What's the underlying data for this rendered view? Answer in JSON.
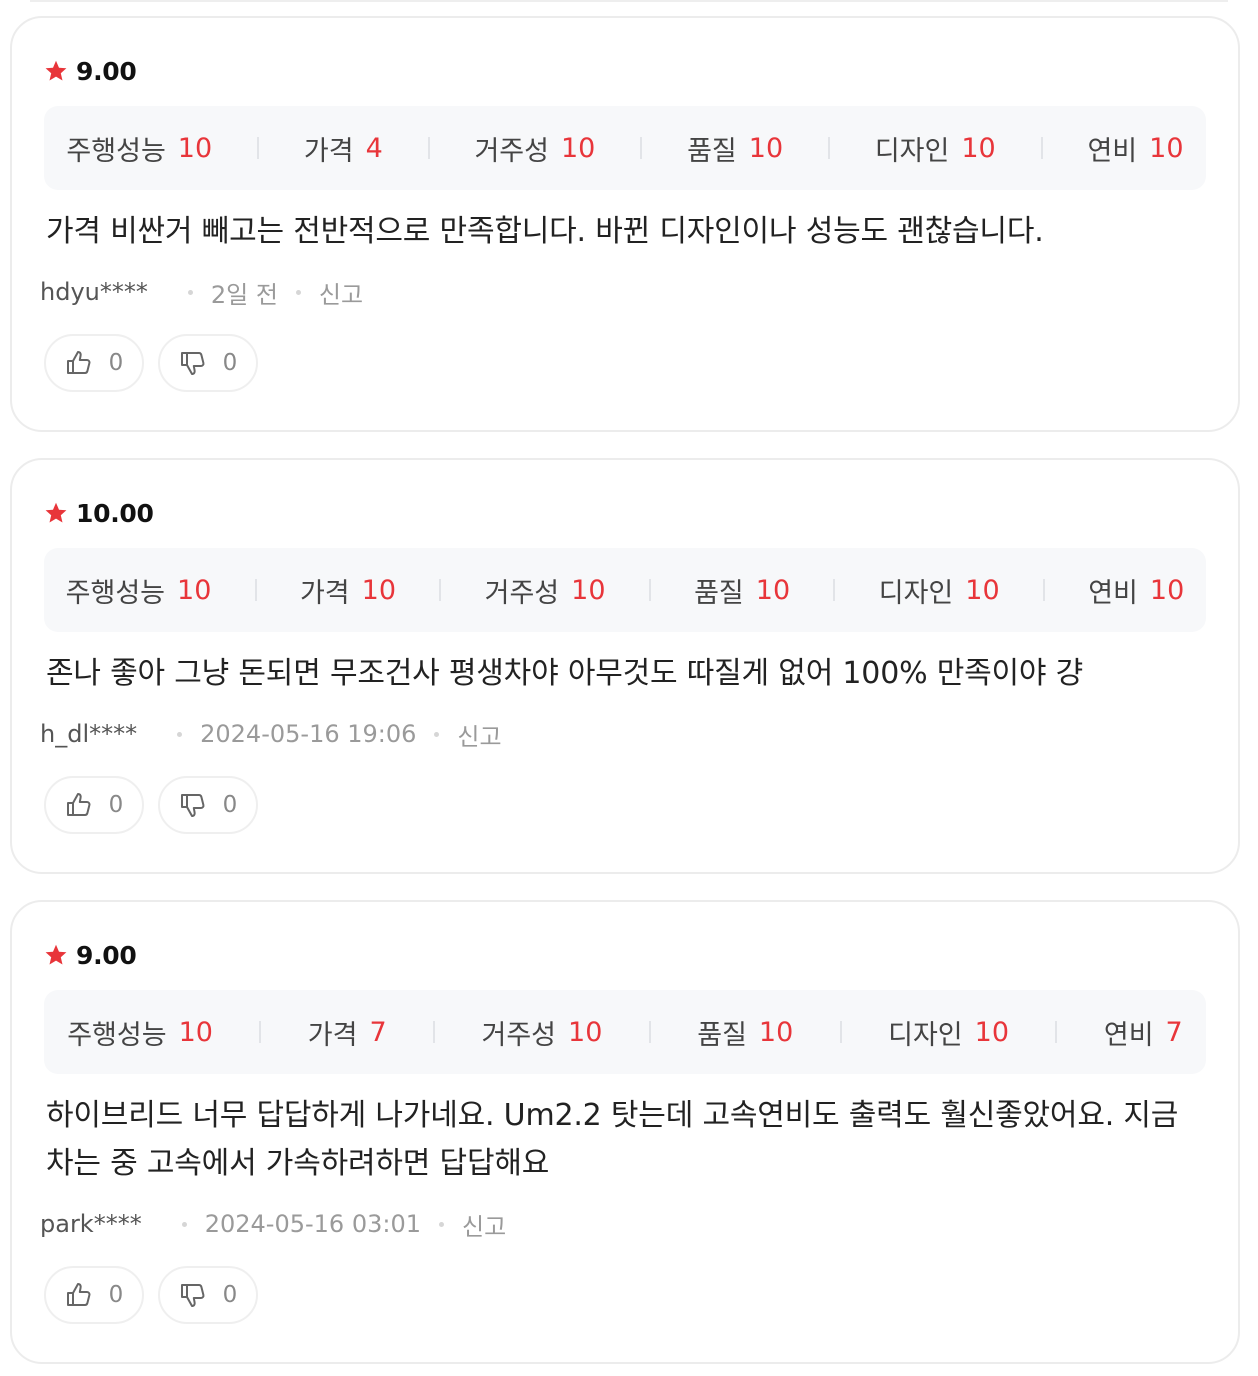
{
  "colors": {
    "accent": "#e8353a",
    "criteria_bg": "#f7f8fa",
    "card_border": "#ececec"
  },
  "reviews": [
    {
      "score": "9.00",
      "criteria": [
        {
          "label": "주행성능",
          "value": "10"
        },
        {
          "label": "가격",
          "value": "4"
        },
        {
          "label": "거주성",
          "value": "10"
        },
        {
          "label": "품질",
          "value": "10"
        },
        {
          "label": "디자인",
          "value": "10"
        },
        {
          "label": "연비",
          "value": "10"
        }
      ],
      "text": "가격 비싼거 빼고는 전반적으로 만족합니다. 바뀐 디자인이나 성능도 괜찮습니다.",
      "author": "hdyu****",
      "date": "2일 전",
      "report_label": "신고",
      "likes": "0",
      "dislikes": "0"
    },
    {
      "score": "10.00",
      "criteria": [
        {
          "label": "주행성능",
          "value": "10"
        },
        {
          "label": "가격",
          "value": "10"
        },
        {
          "label": "거주성",
          "value": "10"
        },
        {
          "label": "품질",
          "value": "10"
        },
        {
          "label": "디자인",
          "value": "10"
        },
        {
          "label": "연비",
          "value": "10"
        }
      ],
      "text": "존나 좋아 그냥 돈되면 무조건사 평생차야 아무것도 따질게 없어 100% 만족이야 걍",
      "author": "h_dl****",
      "date": "2024-05-16 19:06",
      "report_label": "신고",
      "likes": "0",
      "dislikes": "0"
    },
    {
      "score": "9.00",
      "criteria": [
        {
          "label": "주행성능",
          "value": "10"
        },
        {
          "label": "가격",
          "value": "7"
        },
        {
          "label": "거주성",
          "value": "10"
        },
        {
          "label": "품질",
          "value": "10"
        },
        {
          "label": "디자인",
          "value": "10"
        },
        {
          "label": "연비",
          "value": "7"
        }
      ],
      "text": "하이브리드 너무 답답하게 나가네요. Um2.2 탓는데 고속연비도 출력도 훨신좋았어요. 지금 차는 중 고속에서 가속하려하면 답답해요",
      "author": "park****",
      "date": "2024-05-16 03:01",
      "report_label": "신고",
      "likes": "0",
      "dislikes": "0"
    }
  ]
}
